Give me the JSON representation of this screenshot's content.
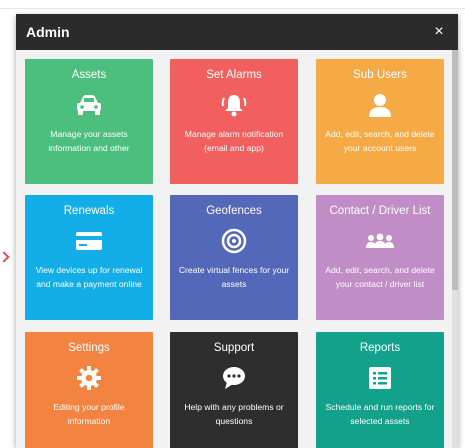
{
  "dialog": {
    "title": "Admin",
    "close_glyph": "×"
  },
  "tiles": [
    {
      "title": "Assets",
      "icon": "car-icon",
      "color": "#4cbf7e",
      "description": "Manage your assets information and other"
    },
    {
      "title": "Set Alarms",
      "icon": "alarm-bell-icon",
      "color": "#f25f5f",
      "description": "Manage alarm notification (email and app)"
    },
    {
      "title": "Sub Users",
      "icon": "user-icon",
      "color": "#f5aa45",
      "description": "Add, edit, search, and delete your account users"
    },
    {
      "title": "Renewals",
      "icon": "credit-card-icon",
      "color": "#13aee8",
      "description": "View devices up for renewal and make a payment online"
    },
    {
      "title": "Geofences",
      "icon": "geofence-target-icon",
      "color": "#5468b9",
      "description": "Create virtual fences for your assets"
    },
    {
      "title": "Contact / Driver List",
      "icon": "people-group-icon",
      "color": "#c18dc6",
      "description": "Add, edit, search, and delete your contact / driver list"
    },
    {
      "title": "Settings",
      "icon": "gear-icon",
      "color": "#f28341",
      "description": "Editing your profile information"
    },
    {
      "title": "Support",
      "icon": "chat-bubble-icon",
      "color": "#2e2e2e",
      "description": "Help with any problems or questions"
    },
    {
      "title": "Reports",
      "icon": "report-list-icon",
      "color": "#12a28b",
      "description": "Schedule and run reports for selected assets"
    }
  ]
}
